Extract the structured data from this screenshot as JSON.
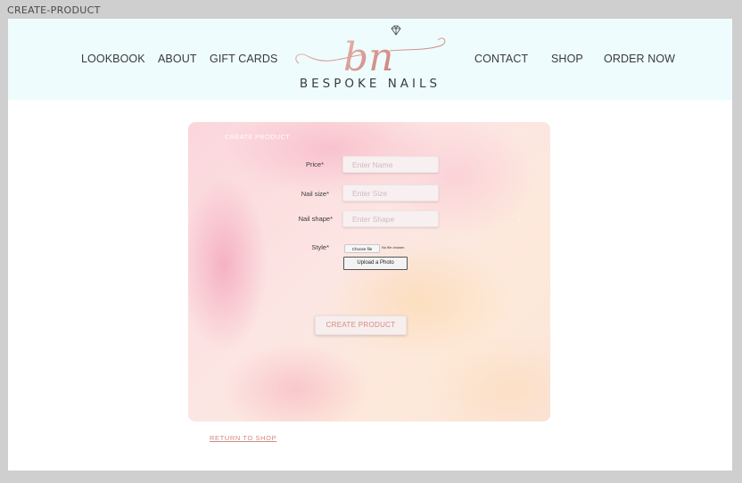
{
  "frame": {
    "title": "CREATE-PRODUCT"
  },
  "nav": {
    "left": [
      "LOOKBOOK",
      "ABOUT",
      "GIFT CARDS"
    ],
    "right": [
      "CONTACT",
      "SHOP",
      "ORDER NOW"
    ]
  },
  "logo": {
    "monogram": "bn",
    "brand": "BESPOKE NAILS",
    "icon": "diamond-icon"
  },
  "form": {
    "heading": "CREATE PRODUCT",
    "price_label": "Price*",
    "price_placeholder": "Enter Name",
    "size_label": "Nail size*",
    "size_placeholder": "Enter Size",
    "shape_label": "Nail shape*",
    "shape_placeholder": "Enter Shape",
    "style_label": "Style*",
    "choose_file": "Choose file",
    "no_file": "No file chosen",
    "upload": "Upload a Photo",
    "submit": "CREATE PRODUCT",
    "marker": "›"
  },
  "footer": {
    "return_link": "RETURN TO SHOP"
  },
  "colors": {
    "header_bg": "#eefcfd",
    "accent": "#d48a80",
    "logo_rose": "#d99a92"
  }
}
